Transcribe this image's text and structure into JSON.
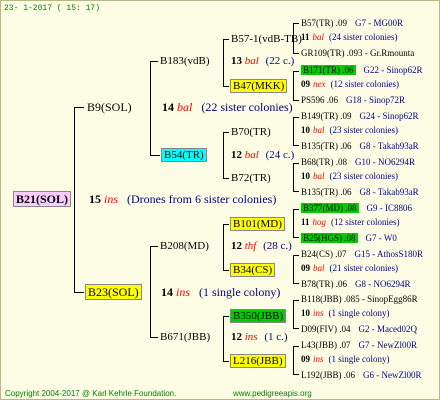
{
  "header": {
    "date": "23-  1-2017  ( 15: 17)"
  },
  "root": {
    "code": "B21(SOL)",
    "gen": "15",
    "word": "ins",
    "note": "(Drones from 6 sister colonies)"
  },
  "upper": {
    "code": "B9(SOL)",
    "gen": "14",
    "word": "bal",
    "note": "(22 sister colonies)",
    "a": {
      "code": "B183(vdB)",
      "gen": "13",
      "word": "bal",
      "note": "(22 c.)",
      "p1": {
        "code": "B57-1(vdB-TB)"
      },
      "p2": {
        "code": "B47(MKK)"
      }
    },
    "b": {
      "code": "B54(TR)",
      "gen": "12",
      "word": "bal",
      "note": "(24 c.)",
      "p1": {
        "code": "B70(TR)"
      },
      "p2": {
        "code": "B72(TR)"
      }
    }
  },
  "lower": {
    "code": "B23(SOL)",
    "gen": "14",
    "word": "ins",
    "note": "(1 single colony)",
    "a": {
      "code": "B208(MD)",
      "gen": "12",
      "word": "thf",
      "note": "(28 c.)",
      "p1": {
        "code": "B101(MD)"
      },
      "p2": {
        "code": "B34(CS)"
      }
    },
    "b": {
      "code": "B671(JBB)",
      "gen": "12",
      "word": "ins",
      "note": "(1 c.)",
      "p1": {
        "code": "B350(JBB)"
      },
      "p2": {
        "code": "L216(JBB)"
      }
    }
  },
  "right": [
    {
      "l": "B57(TR) .09",
      "r": "G7 - MG00R"
    },
    {
      "n": "11",
      "w": "bal",
      "t": "(24 sister colonies)"
    },
    {
      "l": "GR109(TR) .093 - Gr.Rmounta",
      "r": ""
    },
    {
      "l": "B171(TR) .06",
      "r": "G22 - Sinop62R"
    },
    {
      "n": "09",
      "w": "nex",
      "t": "(12 sister colonies)"
    },
    {
      "l": "PS596 .06",
      "r": "G18 - Sinop72R"
    },
    {
      "l": "B149(TR) .09",
      "r": "G24 - Sinop62R"
    },
    {
      "n": "10",
      "w": "bal",
      "t": "(23 sister colonies)"
    },
    {
      "l": "B135(TR) .06",
      "r": "G8 - Takab93aR"
    },
    {
      "l": "B68(TR) .08",
      "r": "G10 - NO6294R"
    },
    {
      "n": "10",
      "w": "bal",
      "t": "(23 sister colonies)"
    },
    {
      "l": "B135(TR) .06",
      "r": "G8 - Takab93aR"
    },
    {
      "l": "B377(MD) .08",
      "r": "G9 - IC8806"
    },
    {
      "n": "11",
      "w": "hog",
      "t": "(12 sister colonies)"
    },
    {
      "l": "B25(HGS) .08",
      "r": "G7 - W0"
    },
    {
      "l": "B24(CS) .07",
      "r": "G15 - AthosS180R"
    },
    {
      "n": "09",
      "w": "bal",
      "t": "(21 sister colonies)"
    },
    {
      "l": "B78(TR) .06",
      "r": "G8 - NO6294R"
    },
    {
      "l": "B118(JBB) .085 - SinopEgg86R",
      "r": ""
    },
    {
      "n": "10",
      "w": "ins",
      "t": "(1 single colony)"
    },
    {
      "l": "D09(FIV) .04",
      "r": "G2 - Maced02Q"
    },
    {
      "l": "L43(JBB) .07",
      "r": "G7 - NewZl00R"
    },
    {
      "n": "09",
      "w": "ins",
      "t": "(1 single colony)"
    },
    {
      "l": "L192(JBB) .06",
      "r": "G6 - NewZl00R"
    }
  ],
  "footer": {
    "left": "Copyright 2004-2017 @ Karl Kehrle Foundation.",
    "right": "www.pedigreeapis.org"
  }
}
